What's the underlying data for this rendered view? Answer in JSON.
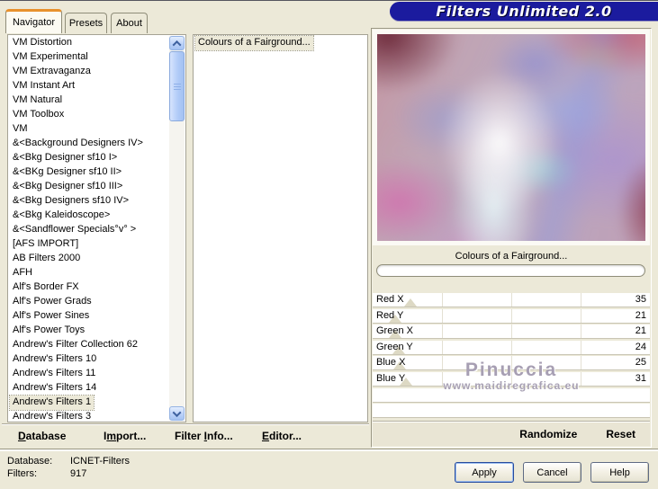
{
  "window": {
    "title": "Filters Unlimited 2.0",
    "colors": {
      "dialog_bg": "#ece9d8",
      "banner_bg": "#1b1b9e",
      "banner_text": "#ffffff",
      "tab_accent": "#e8912d",
      "selection_bg": "#ece9d8",
      "watermark_gray": "#a79fb3"
    }
  },
  "tabs": {
    "items": [
      {
        "label": "Navigator",
        "active": true
      },
      {
        "label": "Presets",
        "active": false
      },
      {
        "label": "About",
        "active": false
      }
    ]
  },
  "navigator_list": {
    "selected_index": 25,
    "items": [
      "VM Distortion",
      "VM Experimental",
      "VM Extravaganza",
      "VM Instant Art",
      "VM Natural",
      "VM Toolbox",
      "VM",
      "&<Background Designers IV>",
      "&<Bkg Designer sf10 I>",
      "&<BKg Designer sf10 II>",
      "&<Bkg Designer sf10 III>",
      "&<Bkg Designers sf10 IV>",
      "&<Bkg Kaleidoscope>",
      "&<Sandflower Specials°v° >",
      "[AFS IMPORT]",
      "AB Filters 2000",
      "AFH",
      "Alf's Border FX",
      "Alf's Power Grads",
      "Alf's Power Sines",
      "Alf's Power Toys",
      "Andrew's Filter Collection 62",
      "Andrew's Filters 10",
      "Andrew's Filters 11",
      "Andrew's Filters 14",
      "Andrew's Filters 1",
      "Andrew's Filters 3"
    ]
  },
  "filter_list": {
    "selected_index": 0,
    "items": [
      "Colours of a Fairground..."
    ]
  },
  "preview": {
    "caption": "Colours of a Fairground...",
    "progress_percent": 0
  },
  "sliders": {
    "max": 255,
    "rows": [
      {
        "label": "Red X",
        "value": 35
      },
      {
        "label": "Red Y",
        "value": 21
      },
      {
        "label": "Green X",
        "value": 21
      },
      {
        "label": "Green Y",
        "value": 24
      },
      {
        "label": "Blue X",
        "value": 25
      },
      {
        "label": "Blue Y",
        "value": 31
      },
      {
        "label": "",
        "value": null
      },
      {
        "label": "",
        "value": null
      }
    ]
  },
  "watermark": {
    "line1": "Pinuccia",
    "line2": "www.maidiregrafica.eu"
  },
  "menu": {
    "items": [
      {
        "pre": "",
        "key": "D",
        "post": "atabase"
      },
      {
        "pre": "I",
        "key": "m",
        "post": "port..."
      },
      {
        "pre": "Filter ",
        "key": "I",
        "post": "nfo..."
      },
      {
        "pre": "",
        "key": "E",
        "post": "ditor..."
      }
    ]
  },
  "panel_actions": {
    "randomize": "Randomize",
    "reset": "Reset"
  },
  "status": {
    "database_label": "Database:",
    "database_value": "ICNET-Filters",
    "filters_label": "Filters:",
    "filters_value": "917"
  },
  "footer_buttons": [
    {
      "label": "Apply",
      "default": true
    },
    {
      "label": "Cancel",
      "default": false
    },
    {
      "label": "Help",
      "default": false
    }
  ]
}
